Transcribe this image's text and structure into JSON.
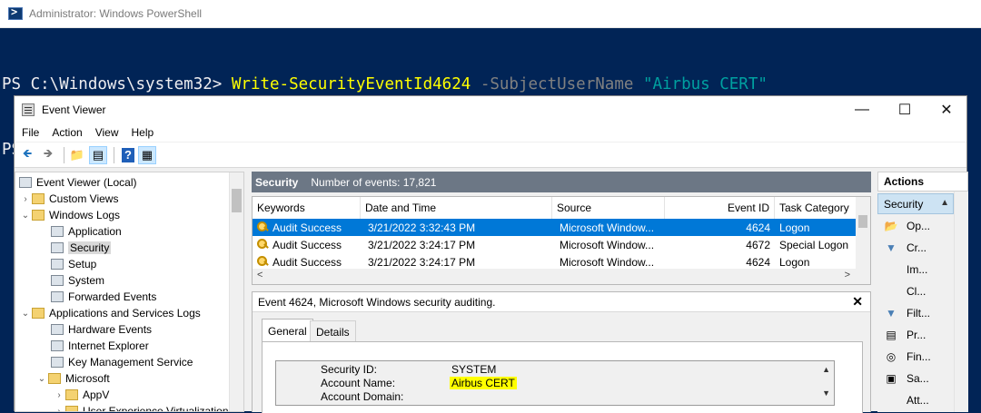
{
  "powershell": {
    "window_title": "Administrator: Windows PowerShell",
    "prompt": "PS C:\\Windows\\system32>",
    "command": "Write-SecurityEventId4624",
    "parameter": "-SubjectUserName",
    "argument": "\"Airbus CERT\""
  },
  "event_viewer": {
    "window_title": "Event Viewer",
    "window_buttons": {
      "minimize": "—",
      "maximize": "☐",
      "close": "✕"
    },
    "menu": [
      "File",
      "Action",
      "View",
      "Help"
    ],
    "toolbar": {
      "back": "🡸",
      "forward": "🡺",
      "up": "📁",
      "show_hide": "▤",
      "help": "?",
      "properties": "▦"
    },
    "tree": {
      "items": [
        {
          "label": "Event Viewer (Local)",
          "arrow": "",
          "icon": "log"
        },
        {
          "label": "Custom Views",
          "arrow": "›",
          "icon": "folder"
        },
        {
          "label": "Windows Logs",
          "arrow": "⌄",
          "icon": "folder"
        },
        {
          "label": "Application",
          "arrow": "",
          "icon": "log"
        },
        {
          "label": "Security",
          "arrow": "",
          "icon": "log",
          "selected": true
        },
        {
          "label": "Setup",
          "arrow": "",
          "icon": "log"
        },
        {
          "label": "System",
          "arrow": "",
          "icon": "log"
        },
        {
          "label": "Forwarded Events",
          "arrow": "",
          "icon": "log"
        },
        {
          "label": "Applications and Services Logs",
          "arrow": "⌄",
          "icon": "folder"
        },
        {
          "label": "Hardware Events",
          "arrow": "",
          "icon": "log"
        },
        {
          "label": "Internet Explorer",
          "arrow": "",
          "icon": "log"
        },
        {
          "label": "Key Management Service",
          "arrow": "",
          "icon": "log"
        },
        {
          "label": "Microsoft",
          "arrow": "⌄",
          "icon": "folder"
        },
        {
          "label": "AppV",
          "arrow": "›",
          "icon": "folder"
        },
        {
          "label": "User Experience Virtualization",
          "arrow": "›",
          "icon": "folder"
        }
      ]
    },
    "middle": {
      "header_title": "Security",
      "header_count": "Number of events: 17,821",
      "columns": [
        "Keywords",
        "Date and Time",
        "Source",
        "Event ID",
        "Task Category"
      ],
      "rows": [
        {
          "keywords": "Audit Success",
          "date": "3/21/2022 3:32:43 PM",
          "source": "Microsoft Window...",
          "event_id": "4624",
          "task": "Logon",
          "selected": true
        },
        {
          "keywords": "Audit Success",
          "date": "3/21/2022 3:24:17 PM",
          "source": "Microsoft Window...",
          "event_id": "4672",
          "task": "Special Logon"
        },
        {
          "keywords": "Audit Success",
          "date": "3/21/2022 3:24:17 PM",
          "source": "Microsoft Window...",
          "event_id": "4624",
          "task": "Logon"
        }
      ],
      "hscroll_left": "<",
      "hscroll_right": ">"
    },
    "detail": {
      "header": "Event 4624, Microsoft Windows security auditing.",
      "close": "✕",
      "tabs": [
        "General",
        "Details"
      ],
      "fields": [
        {
          "label": "Security ID:",
          "value": "SYSTEM"
        },
        {
          "label": "Account Name:",
          "value": "Airbus CERT",
          "highlight": true
        },
        {
          "label": "Account Domain:",
          "value": ""
        }
      ]
    },
    "actions": {
      "header": "Actions",
      "section": "Security",
      "items": [
        {
          "label": "Op...",
          "icon": "📂"
        },
        {
          "label": "Cr...",
          "icon": "▼"
        },
        {
          "label": "Im...",
          "icon": ""
        },
        {
          "label": "Cl...",
          "icon": ""
        },
        {
          "label": "Filt...",
          "icon": "▼"
        },
        {
          "label": "Pr...",
          "icon": "▤"
        },
        {
          "label": "Fin...",
          "icon": "◎"
        },
        {
          "label": "Sa...",
          "icon": "▣"
        },
        {
          "label": "Att...",
          "icon": ""
        }
      ]
    }
  }
}
